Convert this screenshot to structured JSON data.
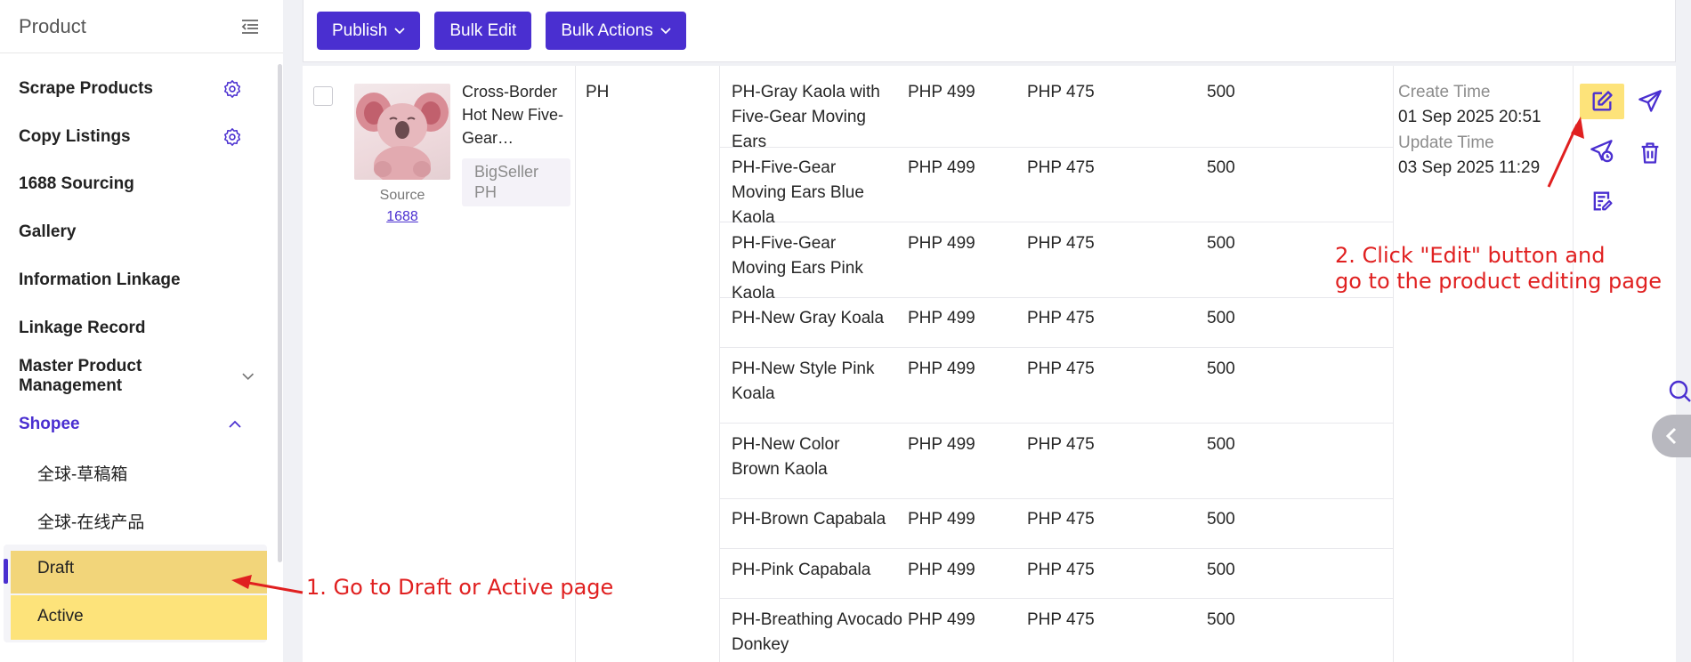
{
  "sidebar": {
    "title": "Product",
    "items": [
      {
        "label": "Scrape Products"
      },
      {
        "label": "Copy Listings"
      },
      {
        "label": "1688 Sourcing"
      },
      {
        "label": "Gallery"
      },
      {
        "label": "Information Linkage"
      },
      {
        "label": "Linkage Record"
      },
      {
        "label": "Master Product Management"
      },
      {
        "label": "Shopee"
      }
    ],
    "sub_items": [
      {
        "label": "全球-草稿箱"
      },
      {
        "label": "全球-在线产品"
      },
      {
        "label": "Draft"
      },
      {
        "label": "Active"
      }
    ]
  },
  "toolbar": {
    "publish_label": "Publish",
    "bulk_edit_label": "Bulk Edit",
    "bulk_actions_label": "Bulk Actions"
  },
  "product": {
    "name": "Cross-Border Hot New Five-Gear…",
    "source_label": "Source",
    "source_link": "1688",
    "store_tag": "BigSeller PH",
    "site": "PH",
    "create_time_label": "Create Time",
    "create_time": "01 Sep 2025 20:51",
    "update_time_label": "Update Time",
    "update_time": "03 Sep 2025 11:29"
  },
  "variants": [
    {
      "name": "PH-Gray Kaola with Five-Gear Moving Ears",
      "price": "PHP 499",
      "sale_price": "PHP 475",
      "stock": "500"
    },
    {
      "name": "PH-Five-Gear Moving Ears Blue Kaola",
      "price": "PHP 499",
      "sale_price": "PHP 475",
      "stock": "500"
    },
    {
      "name": "PH-Five-Gear Moving Ears Pink Kaola",
      "price": "PHP 499",
      "sale_price": "PHP 475",
      "stock": "500"
    },
    {
      "name": "PH-New Gray Koala",
      "price": "PHP 499",
      "sale_price": "PHP 475",
      "stock": "500"
    },
    {
      "name": "PH-New Style Pink Koala",
      "price": "PHP 499",
      "sale_price": "PHP 475",
      "stock": "500"
    },
    {
      "name": "PH-New Color Brown Kaola",
      "price": "PHP 499",
      "sale_price": "PHP 475",
      "stock": "500"
    },
    {
      "name": "PH-Brown Capabala",
      "price": "PHP 499",
      "sale_price": "PHP 475",
      "stock": "500"
    },
    {
      "name": "PH-Pink Capabala",
      "price": "PHP 499",
      "sale_price": "PHP 475",
      "stock": "500"
    },
    {
      "name": "PH-Breathing Avocado Donkey",
      "price": "PHP 499",
      "sale_price": "PHP 475",
      "stock": "500"
    }
  ],
  "annotations": {
    "step1": "1. Go to Draft or Active page",
    "step2_line1": "2. Click \"Edit\" button and",
    "step2_line2": "go to the product editing page"
  },
  "colors": {
    "brand": "#4a2fd0",
    "highlight": "#fde37a",
    "annotation": "#e02020"
  }
}
